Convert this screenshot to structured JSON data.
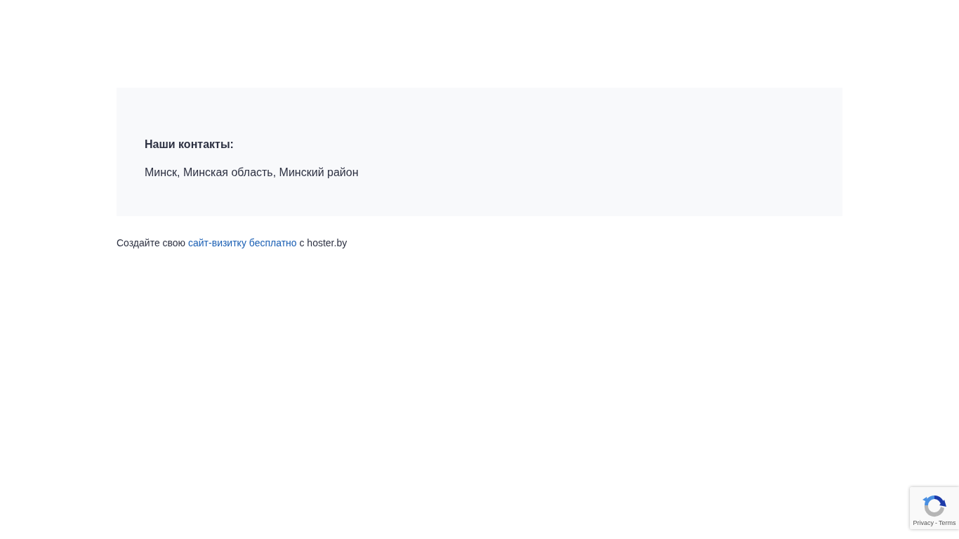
{
  "contacts": {
    "heading": "Наши контакты:",
    "address": "Минск, Минская область, Минский район"
  },
  "footer": {
    "before": "Создайте свою",
    "link": "сайт-визитку бесплатно",
    "after": "с hoster.by"
  },
  "recaptcha": {
    "privacy": "Privacy",
    "separator": "-",
    "terms": "Terms"
  }
}
